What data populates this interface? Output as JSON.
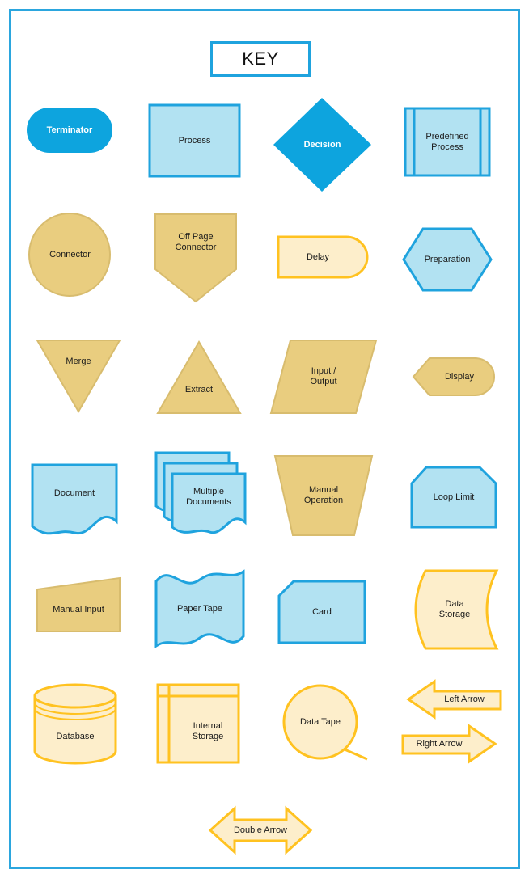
{
  "title": "KEY",
  "palette": {
    "blue_stroke": "#1FA3DE",
    "blue_fill": "#B2E2F2",
    "blue_solid": "#0DA4DE",
    "tan_fill": "#E9CD7F",
    "tan_stroke": "#D8BC6E",
    "gold_stroke": "#FFC220",
    "cream_fill": "#FDEECB",
    "text": "#1b1b1b",
    "white": "#ffffff",
    "frame": "#2BA6DE"
  },
  "shapes": [
    {
      "id": "terminator",
      "label": "Terminator",
      "style": "blue-solid"
    },
    {
      "id": "process",
      "label": "Process",
      "style": "blue"
    },
    {
      "id": "decision",
      "label": "Decision",
      "style": "blue-solid"
    },
    {
      "id": "predefined-process",
      "label": "Predefined\nProcess",
      "style": "blue"
    },
    {
      "id": "connector",
      "label": "Connector",
      "style": "tan"
    },
    {
      "id": "off-page-connector",
      "label": "Off Page\nConnector",
      "style": "tan"
    },
    {
      "id": "delay",
      "label": "Delay",
      "style": "cream"
    },
    {
      "id": "preparation",
      "label": "Preparation",
      "style": "blue"
    },
    {
      "id": "merge",
      "label": "Merge",
      "style": "tan"
    },
    {
      "id": "extract",
      "label": "Extract",
      "style": "tan"
    },
    {
      "id": "input-output",
      "label": "Input /\nOutput",
      "style": "tan"
    },
    {
      "id": "display",
      "label": "Display",
      "style": "tan"
    },
    {
      "id": "document",
      "label": "Document",
      "style": "blue"
    },
    {
      "id": "multiple-documents",
      "label": "Multiple\nDocuments",
      "style": "blue"
    },
    {
      "id": "manual-operation",
      "label": "Manual\nOperation",
      "style": "tan"
    },
    {
      "id": "loop-limit",
      "label": "Loop Limit",
      "style": "blue"
    },
    {
      "id": "manual-input",
      "label": "Manual Input",
      "style": "tan"
    },
    {
      "id": "paper-tape",
      "label": "Paper Tape",
      "style": "blue"
    },
    {
      "id": "card",
      "label": "Card",
      "style": "blue"
    },
    {
      "id": "data-storage",
      "label": "Data\nStorage",
      "style": "cream"
    },
    {
      "id": "database",
      "label": "Database",
      "style": "cream"
    },
    {
      "id": "internal-storage",
      "label": "Internal\nStorage",
      "style": "cream"
    },
    {
      "id": "data-tape",
      "label": "Data Tape",
      "style": "cream"
    },
    {
      "id": "left-arrow",
      "label": "Left Arrow",
      "style": "cream"
    },
    {
      "id": "right-arrow",
      "label": "Right Arrow",
      "style": "cream"
    },
    {
      "id": "double-arrow",
      "label": "Double Arrow",
      "style": "cream"
    }
  ]
}
